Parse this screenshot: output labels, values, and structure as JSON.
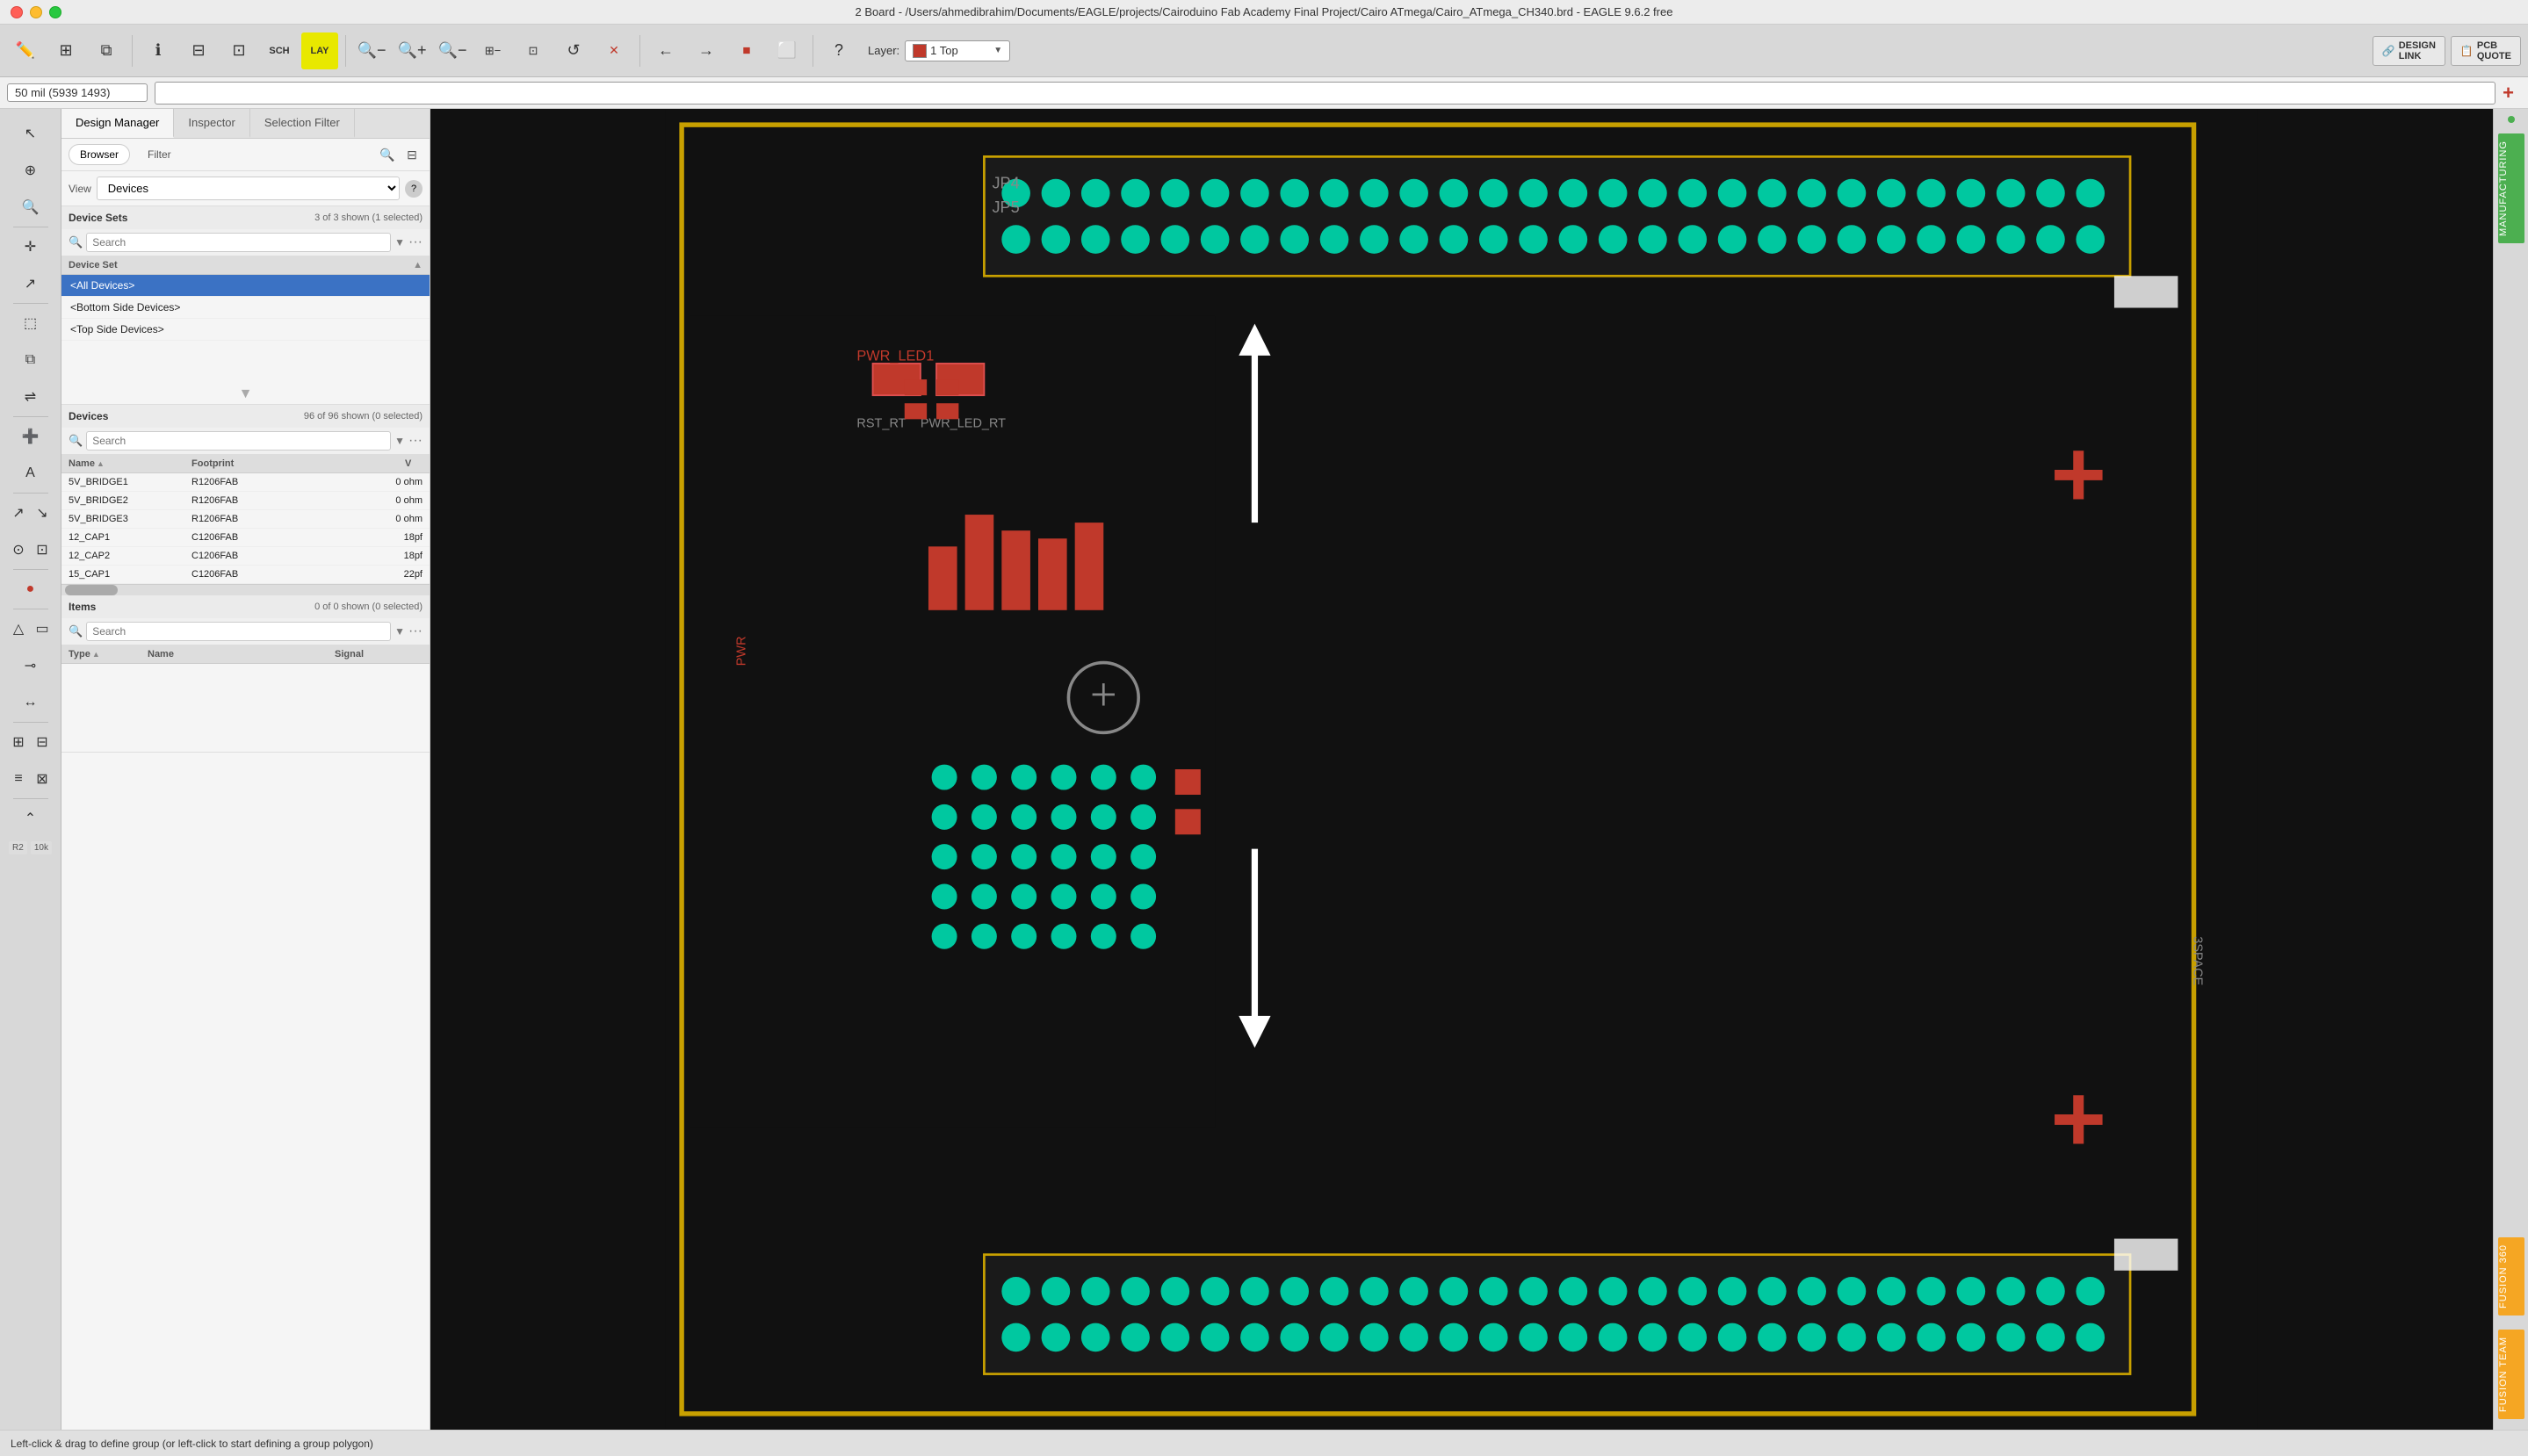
{
  "titlebar": {
    "title": "2 Board - /Users/ahmedibrahim/Documents/EAGLE/projects/Cairoduino Fab Academy Final Project/Cairo ATmega/Cairo_ATmega_CH340.brd - EAGLE 9.6.2 free"
  },
  "toolbar": {
    "layer_label": "Layer:",
    "layer_color": "#c0392b",
    "layer_name": "1 Top",
    "design_link": "DESIGN\nLINK",
    "pcb_quote": "PCB\nQUOTE"
  },
  "coordbar": {
    "coord": "50 mil (5939 1493)",
    "input_placeholder": ""
  },
  "panel": {
    "tabs": [
      "Design Manager",
      "Inspector",
      "Selection Filter"
    ],
    "active_tab": "Design Manager",
    "sub_tabs": [
      "Browser",
      "Filter"
    ],
    "active_sub_tab": "Browser",
    "view_label": "View",
    "view_value": "Devices",
    "device_sets": {
      "title": "Device Sets",
      "count": "3 of 3 shown (1 selected)",
      "search_placeholder": "Search",
      "column": "Device Set",
      "items": [
        {
          "name": "<All Devices>",
          "selected": true
        },
        {
          "name": "<Bottom Side Devices>",
          "selected": false
        },
        {
          "name": "<Top Side Devices>",
          "selected": false
        }
      ]
    },
    "devices": {
      "title": "Devices",
      "count": "96 of 96 shown (0 selected)",
      "search_placeholder": "Search",
      "columns": {
        "name": "Name",
        "footprint": "Footprint",
        "value": ""
      },
      "rows": [
        {
          "name": "5V_BRIDGE1",
          "footprint": "R1206FAB",
          "value": "0 ohm"
        },
        {
          "name": "5V_BRIDGE2",
          "footprint": "R1206FAB",
          "value": "0 ohm"
        },
        {
          "name": "5V_BRIDGE3",
          "footprint": "R1206FAB",
          "value": "0 ohm"
        },
        {
          "name": "12_CAP1",
          "footprint": "C1206FAB",
          "value": "18pf"
        },
        {
          "name": "12_CAP2",
          "footprint": "C1206FAB",
          "value": "18pf"
        },
        {
          "name": "15_CAP1",
          "footprint": "C1206FAB",
          "value": "22pf"
        }
      ]
    },
    "items": {
      "title": "Items",
      "count": "0 of 0 shown (0 selected)",
      "search_placeholder": "Search",
      "columns": {
        "type": "Type",
        "name": "Name",
        "signal": "Signal"
      }
    }
  },
  "statusbar": {
    "text": "Left-click & drag to define group (or left-click to start defining a group polygon)"
  },
  "right_sidebar": {
    "labels": [
      "MANUFACTURING",
      "FUSION 360",
      "FUSION TEAM"
    ]
  },
  "icons": {
    "search": "🔍",
    "gear": "⚙",
    "zoom_in": "+",
    "zoom_out": "−",
    "undo": "↩",
    "redo": "↪",
    "help": "?",
    "cross": "✕",
    "arrow_down": "▼",
    "arrow_up": "▲",
    "dots": "•••",
    "scroll_up": "▲",
    "scroll_down": "▼"
  }
}
